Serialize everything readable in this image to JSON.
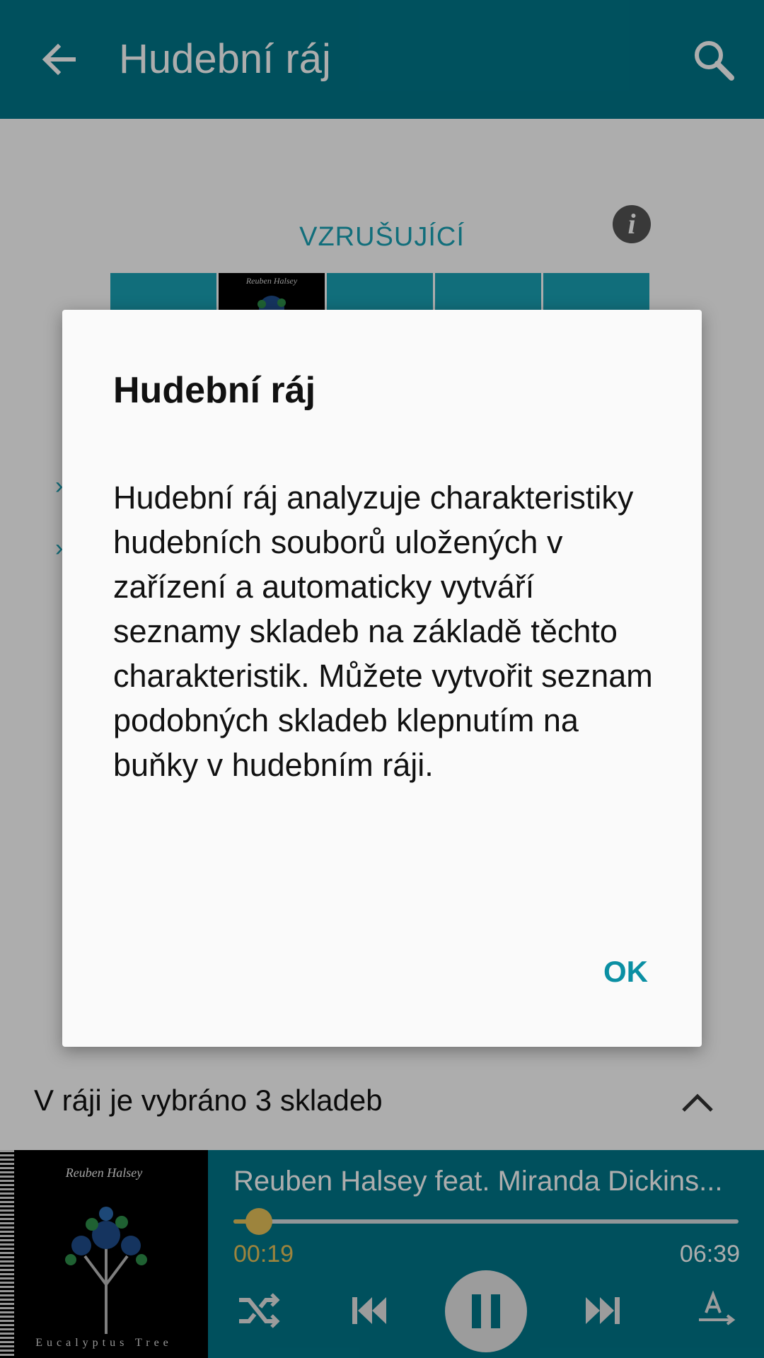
{
  "appbar": {
    "title": "Hudební ráj",
    "back_icon": "arrow-back-icon",
    "search_icon": "search-icon"
  },
  "content": {
    "mood_label": "VZRUŠUJÍCÍ",
    "info_icon": "info-icon"
  },
  "grid_art_label": "Reuben Halsey",
  "selected": {
    "text": "V ráji je vybráno 3 skladeb"
  },
  "player": {
    "album_artist": "Reuben Halsey",
    "album_title": "Eucalyptus Tree",
    "track_title": "Reuben Halsey feat. Miranda Dickins...",
    "current_time": "00:19",
    "total_time": "06:39",
    "progress_fraction": 0.05
  },
  "dialog": {
    "title": "Hudební ráj",
    "body": "Hudební ráj analyzuje charakteristiky hudebních souborů uložených v zařízení a automaticky vytváří seznamy skladeb na základě těchto charakteristik. Můžete vytvořit seznam podobných skladeb klepnutím na buňky v hudebním ráji.",
    "ok_label": "OK"
  },
  "colors": {
    "primary": "#00778a",
    "accent": "#1aa3b5",
    "progress": "#e8c35a"
  }
}
